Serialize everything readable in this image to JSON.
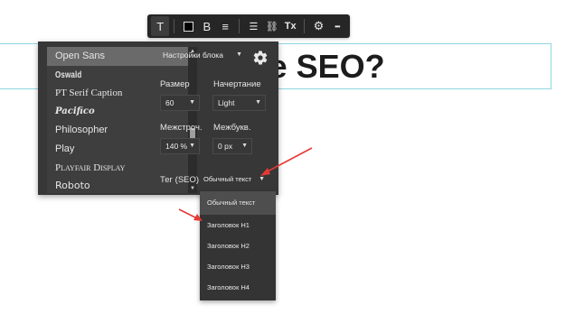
{
  "heading": {
    "text": "Что такое SEO?"
  },
  "toolbar": {
    "buttons": [
      {
        "icon": "text-format-icon",
        "glyph": "T"
      },
      {
        "icon": "text-color-swatch"
      },
      {
        "icon": "bold-icon",
        "glyph": "B"
      },
      {
        "icon": "align-center-icon",
        "glyph": "≡"
      },
      {
        "icon": "list-icon",
        "glyph": "☰"
      },
      {
        "icon": "link-icon",
        "glyph": "⛓"
      },
      {
        "icon": "clear-format-icon",
        "glyph": "Tx"
      },
      {
        "icon": "gear-icon",
        "glyph": "⚙"
      },
      {
        "icon": "more-icon",
        "glyph": "•••"
      }
    ],
    "swatch_color": "#000000"
  },
  "font_panel": {
    "fonts": [
      "Open Sans",
      "Oswald",
      "PT Serif Caption",
      "Pacifico",
      "Philosopher",
      "Play",
      "Playfair Display",
      "Roboto"
    ],
    "selected_font": "Open Sans",
    "block_settings": {
      "label": "Настройки блока",
      "caret": "▼"
    },
    "size": {
      "label": "Размер",
      "value": "60",
      "caret": "▼"
    },
    "weight": {
      "label": "Начертание",
      "value": "Light",
      "caret": "▼"
    },
    "line_height": {
      "label": "Межстроч.",
      "value": "140 %",
      "caret": "▼"
    },
    "letter_spacing": {
      "label": "Межбукв.",
      "value": "0 px",
      "caret": "▼"
    },
    "tag": {
      "label": "Тег (SEO)",
      "value": "Обычный текст",
      "caret": "▼"
    }
  },
  "tag_dropdown": {
    "options": [
      "Обычный текст",
      "Заголовок H1",
      "Заголовок H2",
      "Заголовок H3",
      "Заголовок H4"
    ],
    "selected": "Обычный текст"
  },
  "colors": {
    "panel_bg": "#373737",
    "toolbar_bg": "#262626",
    "arrow": "#e53935",
    "frame": "#8fd6e4"
  }
}
